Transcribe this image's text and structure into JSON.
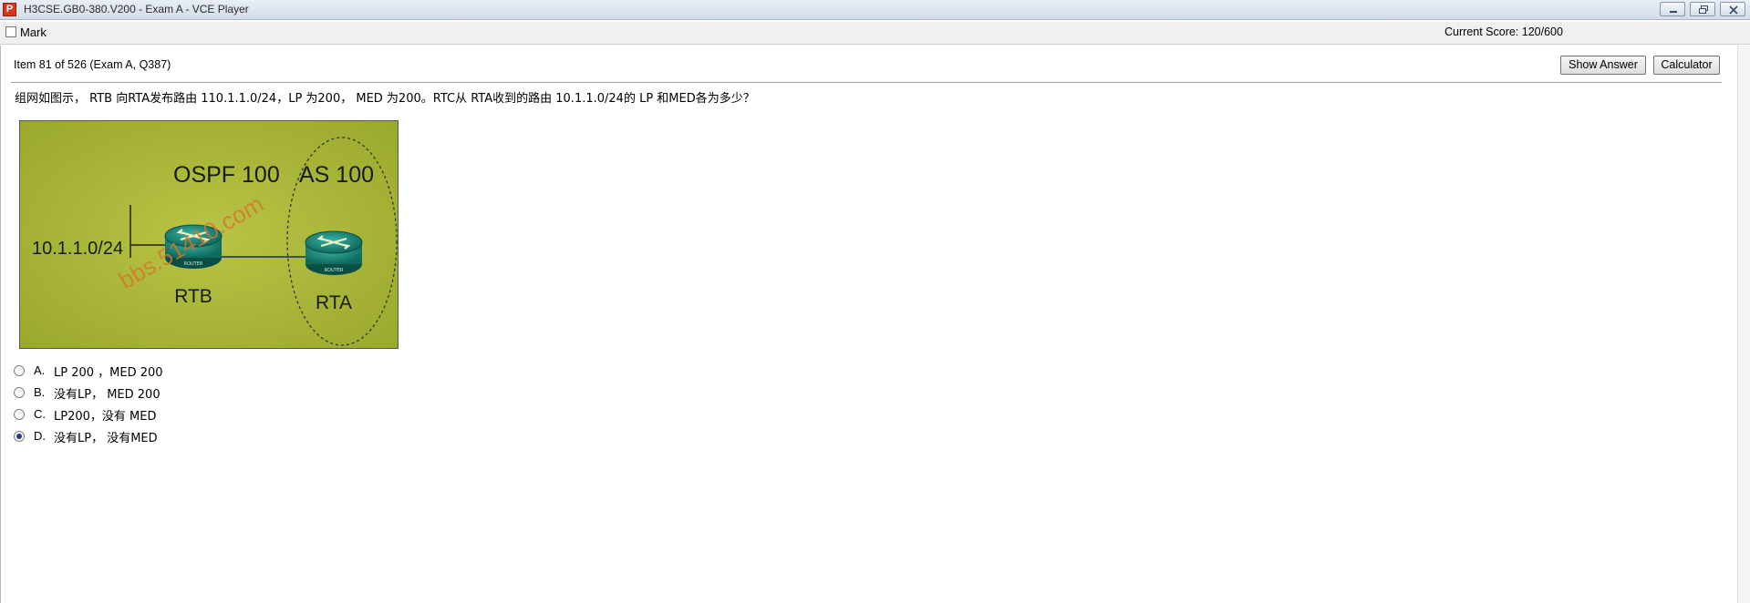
{
  "window": {
    "title": "H3CSE.GB0-380.V200 - Exam A - VCE Player",
    "app_icon": "P"
  },
  "toolbar": {
    "mark_label": "Mark",
    "mark_checked": false,
    "score": "Current Score: 120/600"
  },
  "item": {
    "header": "Item 81 of 526  (Exam A, Q387)",
    "show_answer_label": "Show Answer",
    "calculator_label": "Calculator"
  },
  "question": {
    "text": "组网如图示， RTB 向RTA发布路由 110.1.1.0/24，LP 为200， MED 为200。RTC从 RTA收到的路由 10.1.1.0/24的 LP 和MED各为多少？"
  },
  "exhibit": {
    "ospf_label": "OSPF 100",
    "as_label": "AS 100",
    "network_label": "10.1.1.0/24",
    "router_b_label": "RTB",
    "router_a_label": "RTA",
    "watermark": "bbs.51410.com",
    "router_caption": "ROUTER",
    "background_color": "#a9b534"
  },
  "options": [
    {
      "letter": "A.",
      "text": "LP 200 ，MED 200",
      "selected": false
    },
    {
      "letter": "B.",
      "text": "没有LP， MED 200",
      "selected": false
    },
    {
      "letter": "C.",
      "text": "LP200，没有 MED",
      "selected": false
    },
    {
      "letter": "D.",
      "text": "没有LP， 没有MED",
      "selected": true
    }
  ]
}
